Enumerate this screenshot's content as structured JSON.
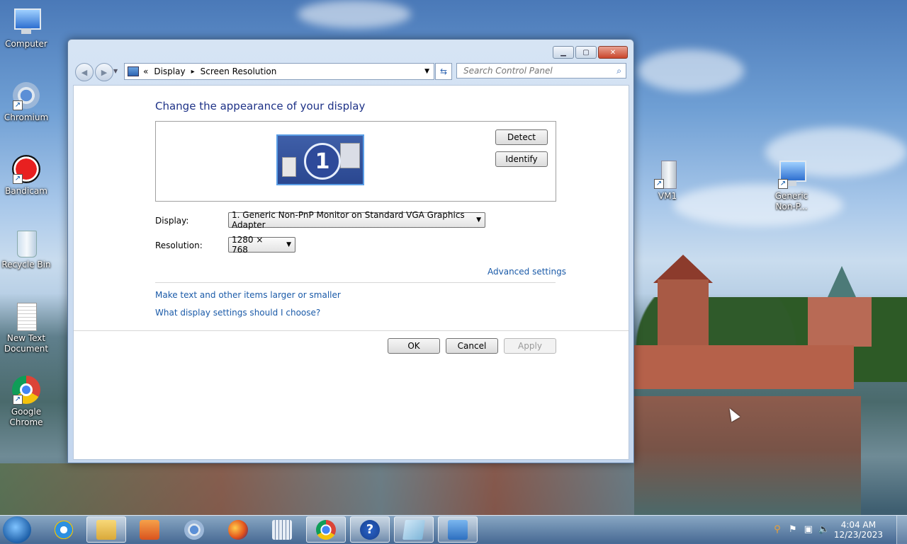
{
  "desktop": {
    "icons": [
      {
        "label": "Computer",
        "icon": "computer-icon"
      },
      {
        "label": "Chromium",
        "icon": "chromium-icon"
      },
      {
        "label": "Bandicam",
        "icon": "bandicam-icon"
      },
      {
        "label": "Recycle Bin",
        "icon": "recycle-bin-icon"
      },
      {
        "label": "New Text Document",
        "icon": "text-document-icon"
      },
      {
        "label": "Google Chrome",
        "icon": "chrome-icon"
      },
      {
        "label": "VM1",
        "icon": "drive-icon"
      },
      {
        "label": "Generic Non-P...",
        "icon": "monitor-icon"
      }
    ]
  },
  "window": {
    "breadcrumb": {
      "chevron": "«",
      "parent": "Display",
      "sep": "▸",
      "current": "Screen Resolution"
    },
    "search": {
      "placeholder": "Search Control Panel"
    },
    "heading": "Change the appearance of your display",
    "monitor": {
      "number": "1"
    },
    "buttons": {
      "detect": "Detect",
      "identify": "Identify",
      "ok": "OK",
      "cancel": "Cancel",
      "apply": "Apply"
    },
    "display": {
      "label": "Display:",
      "value": "1. Generic Non-PnP Monitor on Standard VGA Graphics Adapter"
    },
    "resolution": {
      "label": "Resolution:",
      "value": "1280 × 768"
    },
    "links": {
      "advanced": "Advanced settings",
      "larger": "Make text and other items larger or smaller",
      "which": "What display settings should I choose?"
    }
  },
  "taskbar": {
    "clock": {
      "time": "4:04 AM",
      "date": "12/23/2023"
    },
    "items": [
      "internet-explorer",
      "file-explorer",
      "media-player",
      "chromium",
      "firefox",
      "keyboard",
      "google-chrome",
      "help",
      "notepad",
      "control-panel"
    ],
    "active": [
      "file-explorer",
      "google-chrome",
      "help",
      "notepad",
      "control-panel"
    ]
  }
}
